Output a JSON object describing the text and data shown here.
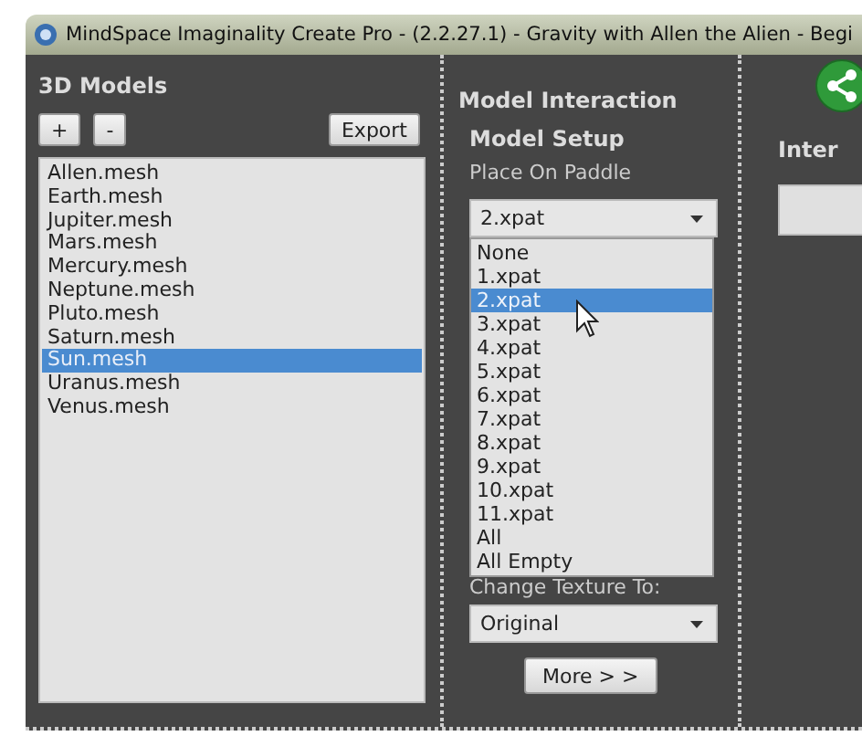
{
  "window": {
    "title": "MindSpace Imaginality Create Pro - (2.2.27.1) - Gravity with Allen the Alien - Begi"
  },
  "models_panel": {
    "title": "3D Models",
    "buttons": [
      "+",
      "-"
    ],
    "export_button": "Export",
    "items": [
      {
        "label": "Allen.mesh",
        "selected": false
      },
      {
        "label": "Earth.mesh",
        "selected": false
      },
      {
        "label": "Jupiter.mesh",
        "selected": false
      },
      {
        "label": "Mars.mesh",
        "selected": false
      },
      {
        "label": "Mercury.mesh",
        "selected": false
      },
      {
        "label": "Neptune.mesh",
        "selected": false
      },
      {
        "label": "Pluto.mesh",
        "selected": false
      },
      {
        "label": "Saturn.mesh",
        "selected": false
      },
      {
        "label": "Sun.mesh",
        "selected": true
      },
      {
        "label": "Uranus.mesh",
        "selected": false
      },
      {
        "label": "Venus.mesh",
        "selected": false
      }
    ]
  },
  "interaction": {
    "title": "Model Interaction",
    "setup_title": "Model Setup",
    "paddle_label": "Place On Paddle",
    "paddle_select": {
      "value": "2.xpat",
      "expanded": true,
      "options": [
        {
          "label": "None",
          "selected": false
        },
        {
          "label": "1.xpat",
          "selected": false
        },
        {
          "label": "2.xpat",
          "selected": true
        },
        {
          "label": "3.xpat",
          "selected": false
        },
        {
          "label": "4.xpat",
          "selected": false
        },
        {
          "label": "5.xpat",
          "selected": false
        },
        {
          "label": "6.xpat",
          "selected": false
        },
        {
          "label": "7.xpat",
          "selected": false
        },
        {
          "label": "8.xpat",
          "selected": false
        },
        {
          "label": "9.xpat",
          "selected": false
        },
        {
          "label": "10.xpat",
          "selected": false
        },
        {
          "label": "11.xpat",
          "selected": false
        },
        {
          "label": "All",
          "selected": false
        },
        {
          "label": "All Empty",
          "selected": false
        }
      ]
    },
    "texture_label": "Change Texture To:",
    "texture_select": {
      "value": "Original"
    },
    "more_button": "More > >"
  },
  "right_panel": {
    "title": "Inter"
  }
}
